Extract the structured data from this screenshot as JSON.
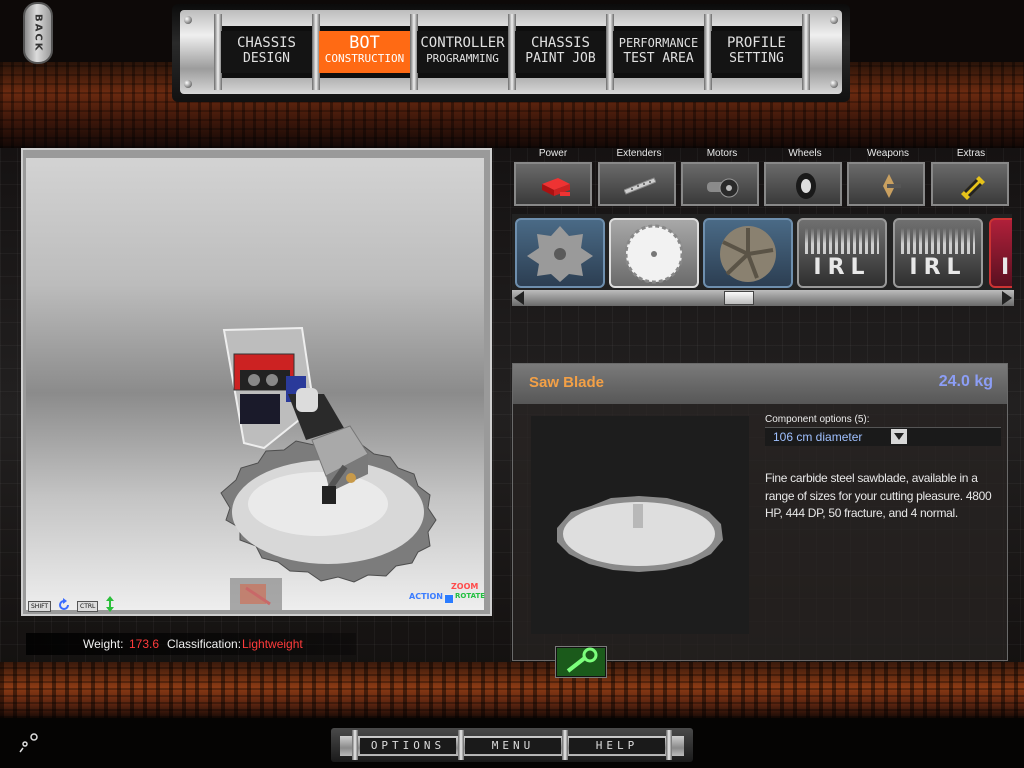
{
  "back_button": {
    "label": "BACK"
  },
  "nav": {
    "tabs": [
      {
        "line1": "CHASSIS",
        "line2": "DESIGN",
        "active": false
      },
      {
        "line1": "BOT",
        "line2": "CONSTRUCTION",
        "active": true
      },
      {
        "line1": "CONTROLLER",
        "line2": "PROGRAMMING",
        "active": false
      },
      {
        "line1": "CHASSIS",
        "line2": "PAINT JOB",
        "active": false
      },
      {
        "line1": "PERFORMANCE",
        "line2": "TEST AREA",
        "active": false
      },
      {
        "line1": "PROFILE",
        "line2": "SETTING",
        "active": false
      }
    ]
  },
  "viewport": {
    "controls": {
      "shift_key": "SHIFT",
      "ctrl_key": "CTRL",
      "zoom_label": "ZOOM",
      "action_label": "ACTION",
      "rotate_label": "ROTATE"
    }
  },
  "status": {
    "weight_label": "Weight:",
    "weight_value": "173.6",
    "class_label": "Classification:",
    "class_value": "Lightweight"
  },
  "categories": [
    {
      "label": "Power",
      "icon": "battery-icon"
    },
    {
      "label": "Extenders",
      "icon": "extender-bar-icon"
    },
    {
      "label": "Motors",
      "icon": "motor-icon"
    },
    {
      "label": "Wheels",
      "icon": "wheel-icon"
    },
    {
      "label": "Weapons",
      "icon": "weapon-icon"
    },
    {
      "label": "Extras",
      "icon": "extras-icon"
    }
  ],
  "parts": [
    {
      "kind": "blade-small",
      "icon": "cutter-blade-icon"
    },
    {
      "kind": "saw-blade",
      "icon": "saw-blade-icon",
      "selected": true
    },
    {
      "kind": "fan-blade",
      "icon": "spinner-disc-icon"
    },
    {
      "kind": "irl",
      "label": "IRL"
    },
    {
      "kind": "irl",
      "label": "IRL"
    },
    {
      "kind": "irl-partial",
      "label": "I"
    }
  ],
  "detail": {
    "name": "Saw Blade",
    "weight": "24.0 kg",
    "options_label": "Component options (5):",
    "option_selected": "106 cm diameter",
    "description": "Fine carbide steel sawblade, available in a range of sizes for your cutting pleasure. 4800 HP, 444 DP, 50 fracture, and 4 normal."
  },
  "bottom_menu": {
    "options": "OPTIONS",
    "menu": "MENU",
    "help": "HELP"
  },
  "colors": {
    "accent_orange": "#ff6a14",
    "part_name": "#f3a046",
    "part_weight": "#8c9ef6",
    "status_value": "#ff3b3b",
    "option_value": "#9fc0ff"
  }
}
